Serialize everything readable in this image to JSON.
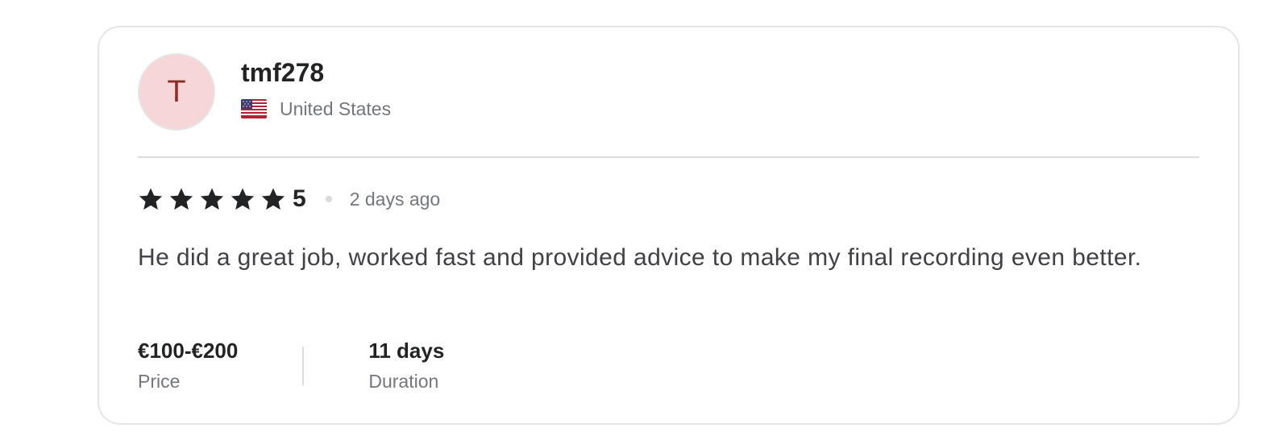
{
  "review": {
    "avatar_initial": "T",
    "username": "tmf278",
    "country": "United States",
    "flag_icon": "us-flag-icon",
    "rating": "5",
    "rating_stars": 5,
    "date": "2 days ago",
    "text": "He did a great job, worked fast and provided advice to make my final recording even better.",
    "stats": [
      {
        "value": "€100-€200",
        "label": "Price"
      },
      {
        "value": "11 days",
        "label": "Duration"
      }
    ]
  },
  "colors": {
    "avatar_bg": "#f7d6d8",
    "avatar_text": "#8f2a2a",
    "star": "#222325",
    "muted_text": "#74767e",
    "border": "#e4e5e7"
  }
}
